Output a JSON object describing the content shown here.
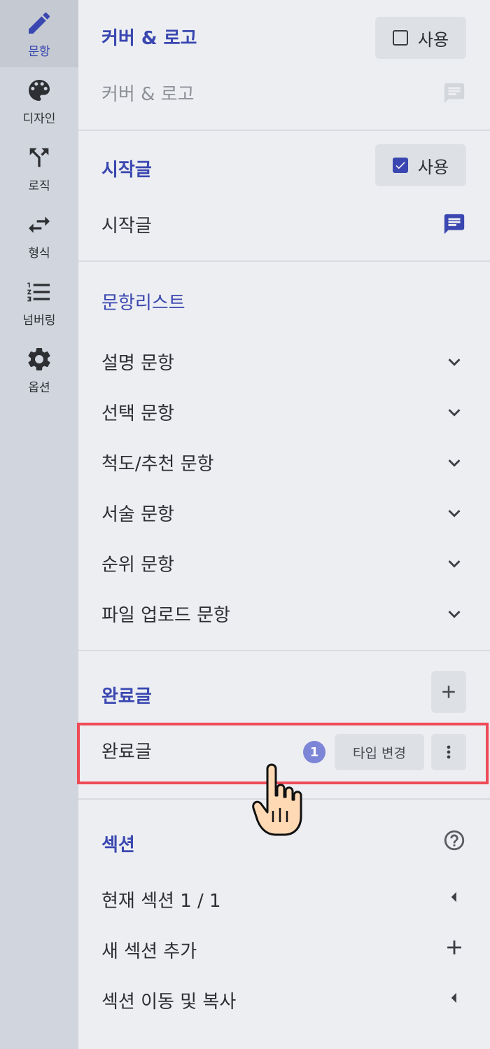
{
  "rail": {
    "items": [
      {
        "label": "문항",
        "icon": "pencil-icon",
        "active": true
      },
      {
        "label": "디자인",
        "icon": "palette-icon"
      },
      {
        "label": "로직",
        "icon": "branch-icon"
      },
      {
        "label": "형식",
        "icon": "swap-arrows-icon"
      },
      {
        "label": "넘버링",
        "icon": "numbered-list-icon"
      },
      {
        "label": "옵션",
        "icon": "gear-icon"
      }
    ]
  },
  "cover": {
    "title": "커버 & 로고",
    "use_label": "사용",
    "use_checked": false,
    "item_label": "커버 & 로고"
  },
  "intro": {
    "title": "시작글",
    "use_label": "사용",
    "use_checked": true,
    "item_label": "시작글"
  },
  "questions": {
    "title": "문항리스트",
    "items": [
      "설명 문항",
      "선택 문항",
      "척도/추천 문항",
      "서술 문항",
      "순위 문항",
      "파일 업로드 문항"
    ]
  },
  "ending": {
    "title": "완료글",
    "item_label": "완료글",
    "badge": "1",
    "type_change_label": "타입 변경"
  },
  "section": {
    "title": "섹션",
    "current_label": "현재 섹션 1 / 1",
    "add_label": "새 섹션 추가",
    "move_label": "섹션 이동 및 복사"
  },
  "colors": {
    "accent": "#3a47b0",
    "highlight": "#ef4b57",
    "badge": "#7d85d6"
  }
}
